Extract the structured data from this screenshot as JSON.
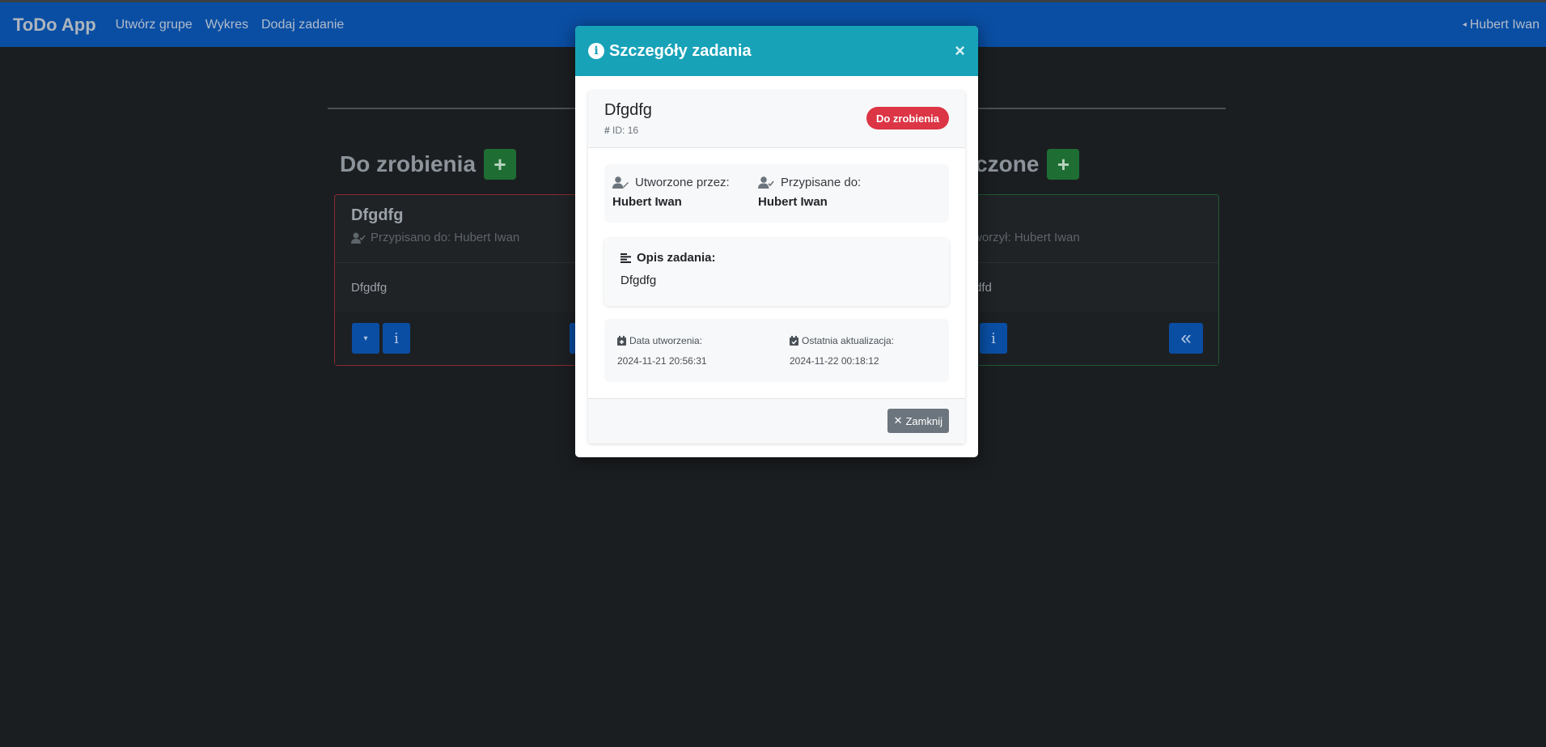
{
  "navbar": {
    "brand": "ToDo App",
    "links": [
      "Utwórz grupe",
      "Wykres",
      "Dodaj zadanie"
    ],
    "user": "Hubert Iwan"
  },
  "board": {
    "todo_heading": "Do zrobienia",
    "done_heading": "ńczone",
    "add_symbol": "+",
    "todo_card": {
      "title": "Dfgdfg",
      "assigned": "Przypisano do: Hubert Iwan",
      "body": "Dfgdfg",
      "info_symbol": "i"
    },
    "done_card": {
      "creator": "worzył: Hubert Iwan",
      "body": "dfd",
      "info_symbol": "i",
      "back_symbol": "«"
    }
  },
  "modal": {
    "title": "Szczegóły zadania",
    "close_symbol": "×",
    "task": {
      "name": "Dfgdfg",
      "id_text": "ID: 16",
      "status": "Do zrobienia",
      "created_by_label": "Utworzone przez:",
      "created_by": "Hubert Iwan",
      "assigned_to_label": "Przypisane do:",
      "assigned_to": "Hubert Iwan",
      "description_label": "Opis zadania:",
      "description": "Dfgdfg",
      "created_date_label": "Data utworzenia:",
      "created_date": "2024-11-21 20:56:31",
      "updated_date_label": "Ostatnia aktualizacja:",
      "updated_date": "2024-11-22 00:18:12"
    },
    "close_button": "Zamknij"
  },
  "colors": {
    "navbar": "#0a4ea3",
    "modal_header": "#17a2b8",
    "status_badge": "#dc3545",
    "success": "#1e6e34"
  }
}
